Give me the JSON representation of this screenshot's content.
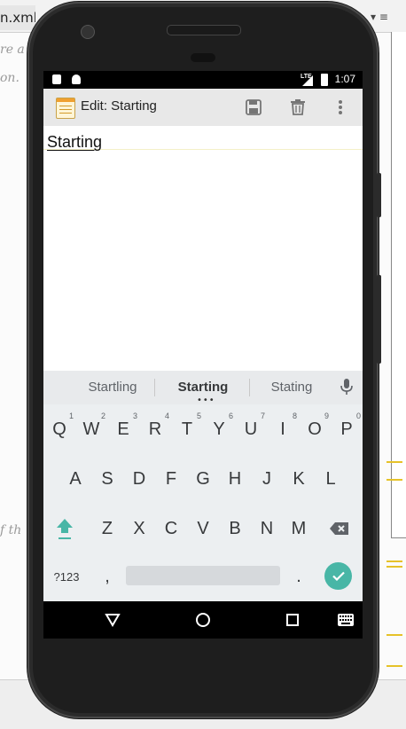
{
  "ide": {
    "tab_label": "n.xml",
    "right_dropdown": "▾ ≡",
    "code_lines": [
      "re a",
      "on.",
      "f th"
    ]
  },
  "status_bar": {
    "time": "1:07",
    "network": "LTE"
  },
  "app_bar": {
    "title": "Edit: Starting",
    "actions": [
      "save-icon",
      "delete-icon",
      "overflow-menu-icon"
    ]
  },
  "editor": {
    "text": "Starting"
  },
  "suggestions": {
    "left": "Startling",
    "center": "Starting",
    "right": "Stating",
    "mic": "microphone-icon"
  },
  "keyboard": {
    "row1": [
      {
        "label": "Q",
        "sup": "1"
      },
      {
        "label": "W",
        "sup": "2"
      },
      {
        "label": "E",
        "sup": "3"
      },
      {
        "label": "R",
        "sup": "4"
      },
      {
        "label": "T",
        "sup": "5"
      },
      {
        "label": "Y",
        "sup": "6"
      },
      {
        "label": "U",
        "sup": "7"
      },
      {
        "label": "I",
        "sup": "8"
      },
      {
        "label": "O",
        "sup": "9"
      },
      {
        "label": "P",
        "sup": "0"
      }
    ],
    "row2": [
      "A",
      "S",
      "D",
      "F",
      "G",
      "H",
      "J",
      "K",
      "L"
    ],
    "row3": [
      "Z",
      "X",
      "C",
      "V",
      "B",
      "N",
      "M"
    ],
    "symbols_label": "?123",
    "comma_label": ",",
    "period_label": ".",
    "shift_icon": "shift-arrow-icon",
    "backspace_icon": "backspace-icon",
    "enter_icon": "checkmark-icon",
    "accent_color": "#48b6a6"
  },
  "nav_bar": {
    "back": "back-triangle-icon",
    "home": "home-circle-icon",
    "recents": "recents-square-icon",
    "keyboard": "keyboard-icon"
  }
}
